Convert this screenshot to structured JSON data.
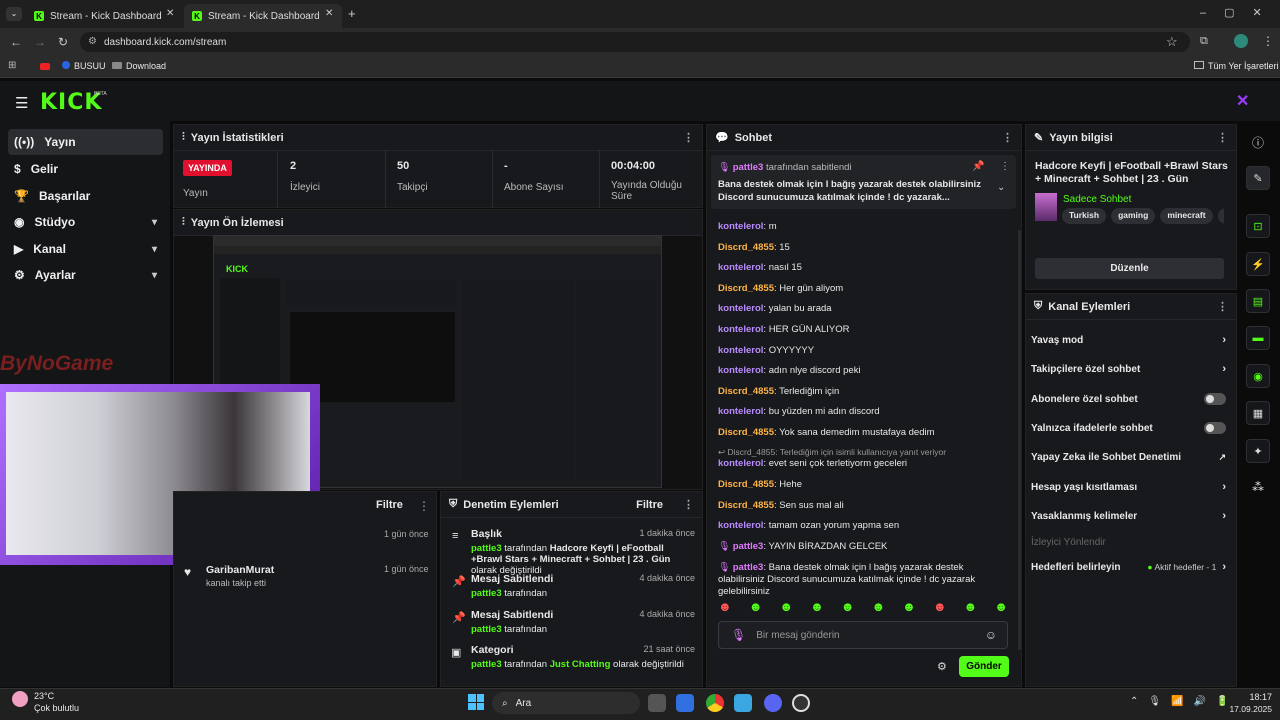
{
  "browser": {
    "tabs": [
      {
        "title": "Stream - Kick Dashboard"
      },
      {
        "title": "Stream - Kick Dashboard"
      }
    ],
    "url": "dashboard.kick.com/stream",
    "bookmarks": [
      "BUSUU",
      "Download"
    ],
    "all_bookmarks": "Tüm Yer İşaretleri"
  },
  "header": {
    "logo": "KICK",
    "beta": "BETA"
  },
  "sidebar": {
    "items": [
      {
        "label": "Yayın"
      },
      {
        "label": "Gelir"
      },
      {
        "label": "Başarılar"
      },
      {
        "label": "Stüdyo"
      },
      {
        "label": "Kanal"
      },
      {
        "label": "Ayarlar"
      }
    ]
  },
  "stats": {
    "title": "Yayın İstatistikleri",
    "live_badge": "YAYINDA",
    "live_label": "Yayın",
    "viewers_value": "2",
    "viewers_label": "İzleyici",
    "followers_value": "50",
    "followers_label": "Takipçi",
    "subs_value": "-",
    "subs_label": "Abone Sayısı",
    "uptime_value": "00:04:00",
    "uptime_label": "Yayında Olduğu Süre"
  },
  "preview": {
    "title": "Yayın Ön İzlemesi",
    "watermark": "ByNoGame"
  },
  "activity": {
    "filter": "Filtre",
    "items": [
      {
        "time": "1 gün önce"
      },
      {
        "name": "GaribanMurat",
        "desc": "kanalı takip etti",
        "time": "1 gün önce"
      }
    ]
  },
  "moderation": {
    "title": "Denetim Eylemleri",
    "filter": "Filtre",
    "items": [
      {
        "title": "Başlık",
        "user": "pattle3",
        "pre": "tarafından",
        "value": "Hadcore Keyfi | eFootball +Brawl Stars + Minecraft + Sohbet | 23 . Gün",
        "post": "olarak değiştirildi",
        "time": "1 dakika önce"
      },
      {
        "title": "Mesaj Sabitlendi",
        "user": "pattle3",
        "pre": "tarafından",
        "time": "4 dakika önce"
      },
      {
        "title": "Mesaj Sabitlendi",
        "user": "pattle3",
        "pre": "tarafından",
        "time": "4 dakika önce"
      },
      {
        "title": "Kategori",
        "user": "pattle3",
        "pre": "tarafından",
        "value": "Just Chatting",
        "post": "olarak değiştirildi",
        "time": "21 saat önce"
      }
    ]
  },
  "chat": {
    "title": "Sohbet",
    "pinned_by": "pattle3",
    "pinned_suffix": "tarafından sabitlendi",
    "pinned_text": "Bana destek olmak için l bağış yazarak destek olabilirsiniz Discord sunucumuza katılmak içinde ! dc yazarak...",
    "messages": [
      {
        "user": "kontelerol",
        "text": "m",
        "c": "u1"
      },
      {
        "user": "Discrd_4855",
        "text": "15",
        "c": "u2"
      },
      {
        "user": "kontelerol",
        "text": "nasıl 15",
        "c": "u1"
      },
      {
        "user": "Discrd_4855",
        "text": "Her gün aliyom",
        "c": "u2"
      },
      {
        "user": "kontelerol",
        "text": "yalan bu arada",
        "c": "u1"
      },
      {
        "user": "kontelerol",
        "text": "HER GÜN ALIYOR",
        "c": "u1"
      },
      {
        "user": "kontelerol",
        "text": "OYYYYYY",
        "c": "u1"
      },
      {
        "user": "kontelerol",
        "text": "adın nlye discord peki",
        "c": "u1"
      },
      {
        "user": "Discrd_4855",
        "text": "Terlediğim için",
        "c": "u2"
      },
      {
        "user": "kontelerol",
        "text": "bu yüzden mi adın discord",
        "c": "u1"
      },
      {
        "user": "Discrd_4855",
        "text": "Yok sana demedim mustafaya dedim",
        "c": "u2"
      }
    ],
    "reply_ref": "Discrd_4855: Terlediğim için isimli kullanıcıya yanıt veriyor",
    "messages2": [
      {
        "user": "kontelerol",
        "text": "evet seni çok terletiyorm geceleri",
        "c": "u1"
      },
      {
        "user": "Discrd_4855",
        "text": "Hehe",
        "c": "u2"
      },
      {
        "user": "Discrd_4855",
        "text": "Sen sus mal ali",
        "c": "u2"
      },
      {
        "user": "kontelerol",
        "text": "tamam ozan yorum yapma sen",
        "c": "u1"
      },
      {
        "user": "pattle3",
        "text": "YAYIN BİRAZDAN GELCEK",
        "c": "u3"
      },
      {
        "user": "pattle3",
        "text": "Bana destek olmak için l bağış yazarak destek olabilirsiniz Discord sunucumuza katılmak içinde ! dc yazarak gelebilirsiniz",
        "c": "u3"
      }
    ],
    "input_placeholder": "Bir mesaj gönderin",
    "send": "Gönder"
  },
  "info": {
    "title": "Yayın bilgisi",
    "stream_title": "Hadcore Keyfi | eFootball +Brawl Stars + Minecraft + Sohbet | 23 . Gün",
    "category": "Sadece Sohbet",
    "tags": [
      "Turkish",
      "gaming",
      "minecraft",
      "cha"
    ],
    "edit": "Düzenle"
  },
  "channel_actions": {
    "title": "Kanal Eylemleri",
    "rows": [
      {
        "label": "Yavaş mod",
        "kind": "arrow"
      },
      {
        "label": "Takipçilere özel sohbet",
        "kind": "arrow"
      },
      {
        "label": "Abonelere özel sohbet",
        "kind": "toggle"
      },
      {
        "label": "Yalnızca ifadelerle sohbet",
        "kind": "toggle"
      },
      {
        "label": "Yapay Zeka ile Sohbet Denetimi",
        "kind": "ext"
      },
      {
        "label": "Hesap yaşı kısıtlaması",
        "kind": "arrow"
      },
      {
        "label": "Yasaklanmış kelimeler",
        "kind": "arrow"
      }
    ],
    "disabled": "İzleyici Yönlendir",
    "goals": "Hedefleri belirleyin",
    "goals_status": "Aktif hedefler - 1"
  },
  "taskbar": {
    "temp": "23°C",
    "weather": "Çok bulutlu",
    "search": "Ara",
    "time": "18:17",
    "date": "17.09.2025"
  },
  "colors": {
    "accent": "#53fc18",
    "live": "#e0102e"
  }
}
